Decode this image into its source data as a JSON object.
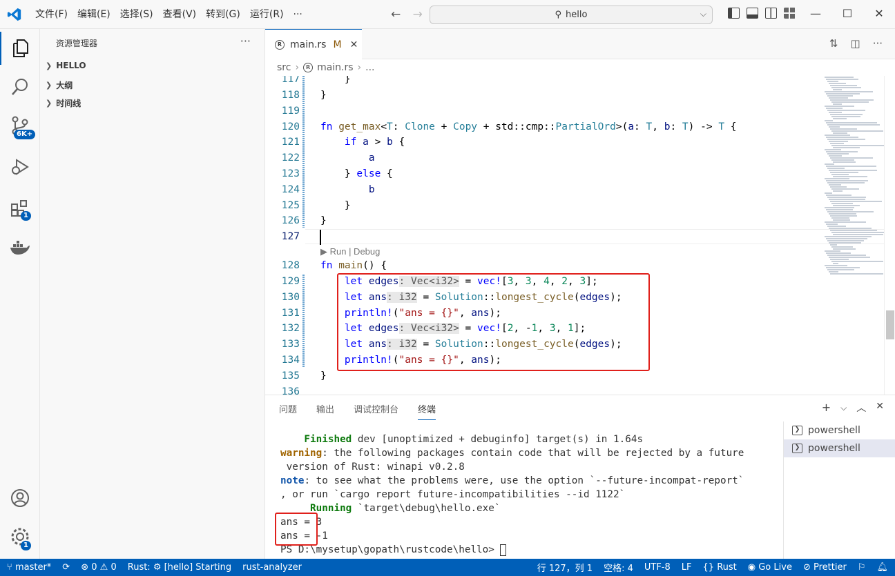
{
  "titlebar": {
    "menu": [
      "文件(F)",
      "编辑(E)",
      "选择(S)",
      "查看(V)",
      "转到(G)",
      "运行(R)",
      "···"
    ],
    "search_text": "hello"
  },
  "activity": {
    "scm_badge": "6K+",
    "ext_badge": "1",
    "settings_badge": "1"
  },
  "sidebar": {
    "title": "资源管理器",
    "sections": [
      "HELLO",
      "大纲",
      "时间线"
    ]
  },
  "tab": {
    "name": "main.rs",
    "modified": "M"
  },
  "breadcrumb": {
    "folder": "src",
    "file": "main.rs",
    "more": "..."
  },
  "editor": {
    "codelens": "▶ Run | Debug",
    "line_numbers": [
      "117",
      "118",
      "119",
      "120",
      "121",
      "122",
      "123",
      "124",
      "125",
      "126",
      "127",
      "128",
      "129",
      "130",
      "131",
      "132",
      "133",
      "134",
      "135",
      "136"
    ]
  },
  "panel": {
    "tabs": [
      "问题",
      "输出",
      "调试控制台",
      "终端"
    ],
    "terminals": [
      "powershell",
      "powershell"
    ],
    "terminal_lines": {
      "l1a": "    Finished",
      "l1b": " dev [unoptimized + debuginfo] target(s) in 1.64s",
      "l2a": "warning",
      "l2b": ": the following packages contain code that will be rejected by a future",
      "l3": " version of Rust: winapi v0.2.8",
      "l4a": "note",
      "l4b": ": to see what the problems were, use the option `--future-incompat-report`",
      "l5": ", or run `cargo report future-incompatibilities --id 1122`",
      "l6a": "     Running",
      "l6b": " `target\\debug\\hello.exe`",
      "l7": "ans = 3",
      "l8": "ans = -1",
      "l9": "PS D:\\mysetup\\gopath\\rustcode\\hello> "
    }
  },
  "statusbar": {
    "branch": "master*",
    "errors": "0",
    "warnings": "0",
    "rust_status": "Rust: ⚙ [hello] Starting",
    "analyzer": "rust-analyzer",
    "position": "行 127，列 1",
    "spaces": "空格: 4",
    "encoding": "UTF-8",
    "eol": "LF",
    "language": "Rust",
    "golive": "Go Live",
    "prettier": "Prettier"
  },
  "colors": {
    "accent": "#005fb8",
    "highlight_box": "#e0201b",
    "keyword": "#0000ff",
    "type": "#267f99",
    "number": "#098658"
  }
}
